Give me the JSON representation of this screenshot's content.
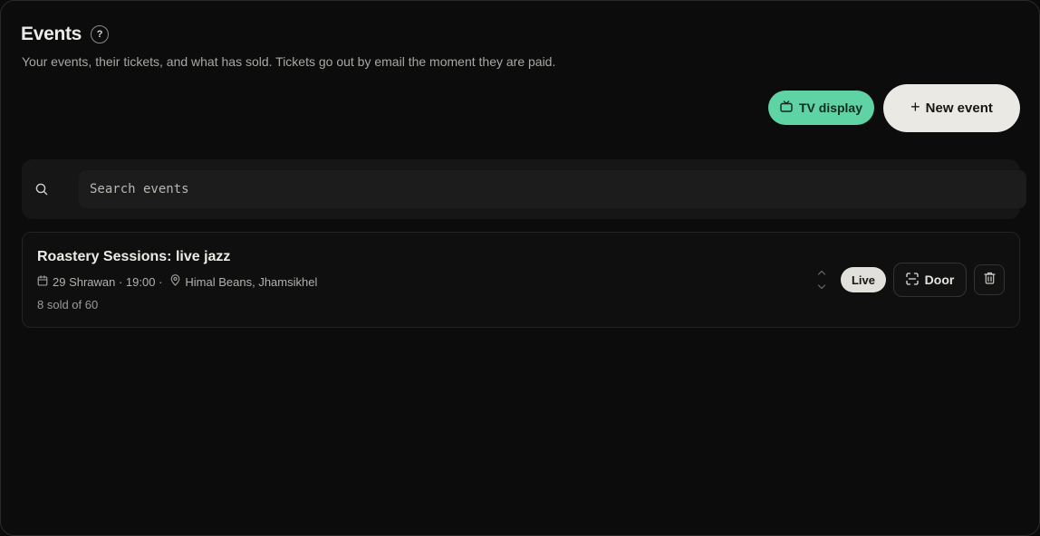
{
  "header": {
    "title": "Events",
    "help_label": "?",
    "subtitle": "Your events, their tickets, and what has sold. Tickets go out by email the moment they are paid."
  },
  "actions": {
    "tv_display_label": "TV display",
    "new_event_plus": "+",
    "new_event_label": "New event"
  },
  "search": {
    "placeholder": "Search events",
    "value": ""
  },
  "events": [
    {
      "title": "Roastery Sessions: live jazz",
      "date_time": "29 Shrawan · 19:00 ·",
      "venue": "Himal Beans, Jhamsikhel",
      "sold": "8 sold of 60",
      "status": "Live",
      "door_label": "Door"
    }
  ],
  "icons": {
    "help": "help-icon",
    "tv": "tv-icon",
    "plus": "plus-icon",
    "search": "search-icon",
    "calendar": "calendar-icon",
    "location": "map-pin-icon",
    "reorder": "chevron-up-down-icon",
    "scan": "scan-icon",
    "delete": "trash-icon"
  },
  "colors": {
    "background": "#0c0c0c",
    "accent_green": "#5fd3a3",
    "primary_button": "#ebe9e3",
    "live_badge": "#e2e0da"
  }
}
